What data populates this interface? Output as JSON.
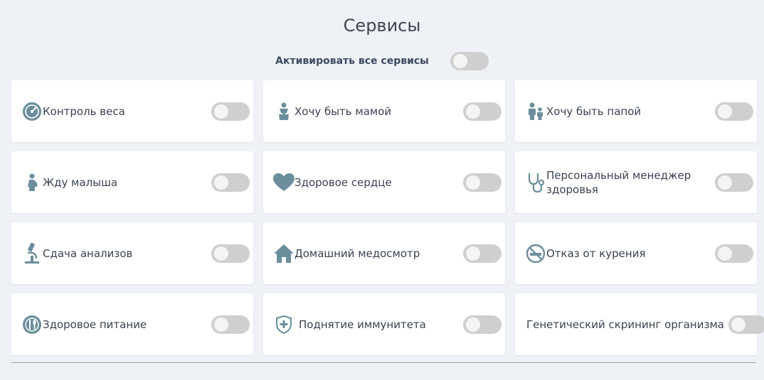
{
  "page": {
    "title": "Сервисы"
  },
  "activate_all": {
    "label": "Активировать все сервисы",
    "enabled": false
  },
  "colors": {
    "icon": "#6c8e9c",
    "toggle_off": "#cfcfcf",
    "card_bg": "#ffffff",
    "page_bg": "#eef1f6"
  },
  "services": [
    {
      "name": "Контроль веса",
      "icon": "scale-gauge-icon",
      "enabled": false
    },
    {
      "name": "Хочу быть мамой",
      "icon": "mother-baby-icon",
      "enabled": false
    },
    {
      "name": "Хочу быть папой",
      "icon": "father-child-icon",
      "enabled": false
    },
    {
      "name": "Жду малыша",
      "icon": "pregnant-icon",
      "enabled": false
    },
    {
      "name": "Здоровое сердце",
      "icon": "heart-icon",
      "enabled": false
    },
    {
      "name": "Персональный менеджер здоровья",
      "icon": "stethoscope-icon",
      "enabled": false
    },
    {
      "name": "Сдача анализов",
      "icon": "microscope-icon",
      "enabled": false
    },
    {
      "name": "Домашний медосмотр",
      "icon": "house-icon",
      "enabled": false
    },
    {
      "name": "Отказ от курения",
      "icon": "no-smoking-icon",
      "enabled": false
    },
    {
      "name": "Здоровое питание",
      "icon": "plate-cutlery-icon",
      "enabled": false
    },
    {
      "name": "Поднятие иммунитета",
      "icon": "shield-cross-icon",
      "enabled": false
    },
    {
      "name": "Генетический скрининг организма",
      "icon": "",
      "enabled": false
    }
  ]
}
